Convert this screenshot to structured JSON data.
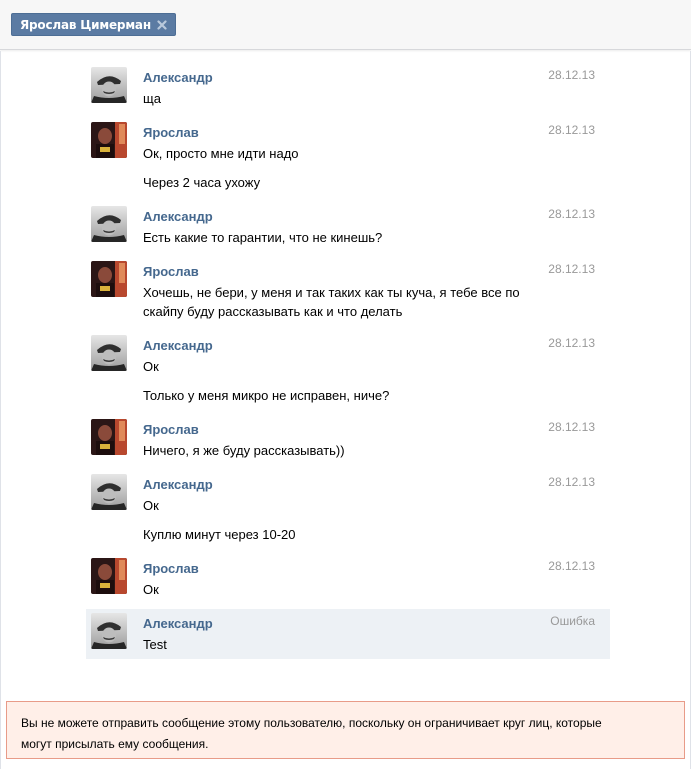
{
  "tab": {
    "label": "Ярослав Цимерман",
    "close_icon": "close-icon"
  },
  "messages": [
    {
      "author": "Александр",
      "avatar": "alexander-avatar",
      "date": "28.12.13",
      "lines": [
        "ща"
      ]
    },
    {
      "author": "Ярослав",
      "avatar": "yaroslav-avatar",
      "date": "28.12.13",
      "lines": [
        "Ок, просто мне идти надо"
      ]
    },
    {
      "author": "",
      "avatar": "",
      "date": "",
      "lines": [
        "Через 2 часа ухожу"
      ]
    },
    {
      "author": "Александр",
      "avatar": "alexander-avatar",
      "date": "28.12.13",
      "lines": [
        "Есть какие то гарантии, что не кинешь?"
      ]
    },
    {
      "author": "Ярослав",
      "avatar": "yaroslav-avatar",
      "date": "28.12.13",
      "lines": [
        "Хочешь, не бери, у меня и так таких как ты куча, я тебе все по",
        "скайпу буду рассказывать как и что делать"
      ]
    },
    {
      "author": "Александр",
      "avatar": "alexander-avatar",
      "date": "28.12.13",
      "lines": [
        "Ок"
      ]
    },
    {
      "author": "",
      "avatar": "",
      "date": "",
      "lines": [
        "Только у меня микро не исправен, ниче?"
      ]
    },
    {
      "author": "Ярослав",
      "avatar": "yaroslav-avatar",
      "date": "28.12.13",
      "lines": [
        "Ничего, я же буду рассказывать))"
      ]
    },
    {
      "author": "Александр",
      "avatar": "alexander-avatar",
      "date": "28.12.13",
      "lines": [
        "Ок"
      ]
    },
    {
      "author": "",
      "avatar": "",
      "date": "",
      "lines": [
        "Куплю минут через 10-20"
      ]
    },
    {
      "author": "Ярослав",
      "avatar": "yaroslav-avatar",
      "date": "28.12.13",
      "lines": [
        "Ок"
      ]
    },
    {
      "author": "Александр",
      "avatar": "alexander-avatar",
      "date": "Ошибка",
      "lines": [
        "Test"
      ],
      "status": "error"
    }
  ],
  "alert": {
    "line1": "Вы не можете отправить сообщение этому пользователю, поскольку он ограничивает круг лиц, которые",
    "line2": "могут присылать ему сообщения."
  },
  "colors": {
    "author": "#45688e",
    "tab": "#5b7ba3",
    "alert_bg": "#ffefe8",
    "alert_border": "#e89b88",
    "error_row": "#edf1f5"
  }
}
